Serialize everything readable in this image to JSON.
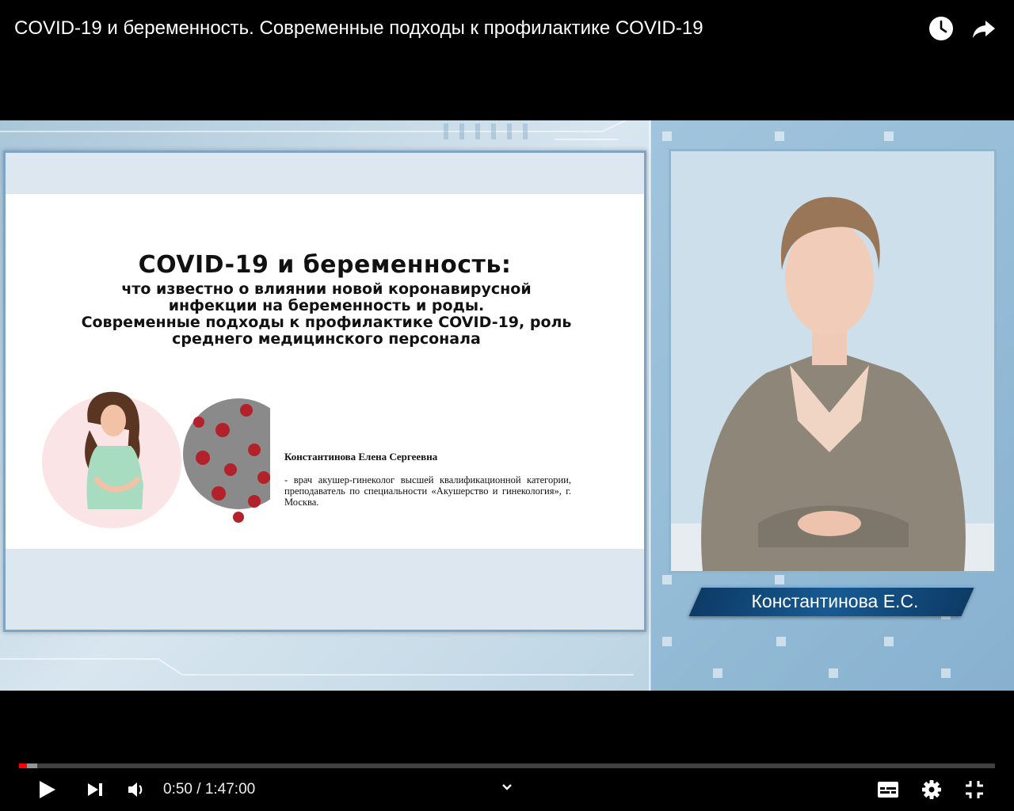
{
  "video": {
    "title": "COVID-19 и беременность. Современные подходы к профилактике COVID-19",
    "icons": {
      "watch_later": "clock-icon",
      "share": "share-arrow-icon"
    }
  },
  "slide": {
    "title": "COVID-19 и беременность:",
    "subtitle_lines": [
      "что известно о влиянии новой коронавирусной",
      "инфекции на беременность и роды.",
      "Современные подходы к профилактике COVID-19, роль",
      "среднего медицинского персонала"
    ],
    "author_name": "Константинова Елена Сергеевна",
    "author_desc": "- врач акушер-гинеколог высшей квалификационной категории, преподаватель по специальности «Акушерство и гинекология», г. Москва."
  },
  "speaker": {
    "nameplate": "Константинова Е.С."
  },
  "player": {
    "current_time": "0:50",
    "separator": " / ",
    "duration": "1:47:00",
    "played_fraction": 0.0078,
    "loaded_fraction": 0.019,
    "icons": {
      "play": "play-icon",
      "next": "next-icon",
      "volume": "volume-icon",
      "chevron": "chevron-down-icon",
      "subtitles": "subtitles-icon",
      "settings": "gear-icon",
      "fullscreen": "fullscreen-icon"
    },
    "accent_color": "#ff0000"
  }
}
